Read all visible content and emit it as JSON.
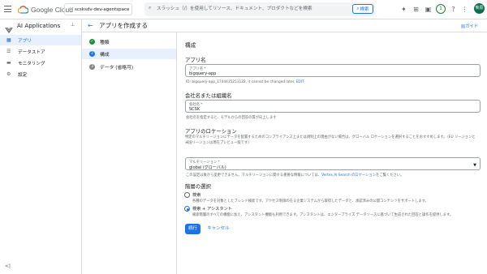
{
  "topbar": {
    "logo_text": "Google Cloud",
    "project": "scsksdv-dev-agentspace",
    "search_placeholder": "スラッシュ（/）を使用してリソース、ドキュメント、プロダクトなどを検索",
    "search_button": "検索",
    "notification_count": "1",
    "avatar_text": "柴原"
  },
  "sidebar": {
    "title": "AI Applications",
    "items": [
      {
        "label": "アプリ",
        "icon": "apps-icon"
      },
      {
        "label": "データストア",
        "icon": "database-icon"
      },
      {
        "label": "モニタリング",
        "icon": "monitoring-icon"
      },
      {
        "label": "設定",
        "icon": "gear-icon"
      }
    ],
    "collapse_label": "<|"
  },
  "header": {
    "title": "アプリを作成する",
    "guide": "ガイド"
  },
  "steps": [
    {
      "num": "✓",
      "label": "種類"
    },
    {
      "num": "2",
      "label": "構成"
    },
    {
      "num": "3",
      "label": "データ (省略可)"
    }
  ],
  "form": {
    "section_title": "構成",
    "app_name": {
      "heading": "アプリ名",
      "label": "アプリ名 *",
      "value": "bigquery-app",
      "id_text": "ID: bigquery-app_1744435251122, it cannot be changed later.",
      "edit": "EDIT"
    },
    "company": {
      "heading": "会社名または組織名",
      "label": "会社名 *",
      "value": "SCSK",
      "help": "会社名を指定すると、モデルからの回答の質が向上します"
    },
    "location": {
      "heading": "アプリのロケーション",
      "para": "特定のマルチリージョンにデータを配置するためのコンプライアンス上または規制上の理由がない場合は、グローバル ロケーションを選択することをおすすめします。（EU リージョンと米国リージョンは現在プレビュー版です）",
      "label": "マルチリージョン *",
      "value": "global (グローバル)",
      "help": "この設定は後から変更できません。マルチリージョンに関する重要な情報については、",
      "help_link": "Vertex AI Search のロケーション",
      "help_tail": "をご覧ください。"
    },
    "tier": {
      "heading": "階層の選択",
      "options": [
        {
          "label": "検索",
          "desc": "各種のデータを対象としたブレンド検索です。アクセス制御の在る企業システムから取得したデータと、承認済みの公開コンテンツをサポートします。",
          "selected": false
        },
        {
          "label": "検索 + アシスタント",
          "desc": "検索階層のすべての機能に加え、アシスタント機能も利用できます。アシスタントは、エンタープライズ データソースに基づいて生成された回答と操作を提供します。",
          "selected": true
        }
      ]
    },
    "run_button": "続行",
    "cancel_button": "キャンセル"
  }
}
